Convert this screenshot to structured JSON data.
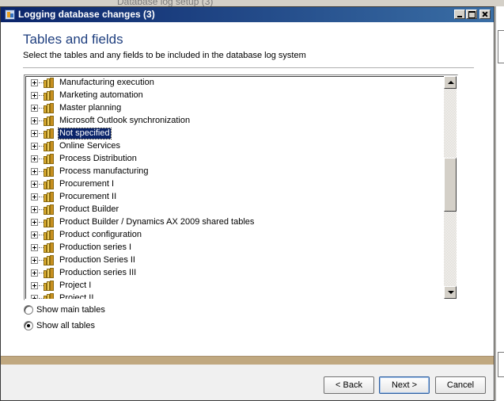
{
  "background": {
    "window_title": "Database log setup (3)"
  },
  "window": {
    "title": "Logging database changes (3)"
  },
  "page": {
    "heading": "Tables and fields",
    "subheading": "Select the tables and any fields to be included in the database log system"
  },
  "tree": {
    "selected_index": 4,
    "items": [
      {
        "label": "Manufacturing execution"
      },
      {
        "label": "Marketing automation"
      },
      {
        "label": "Master planning"
      },
      {
        "label": "Microsoft Outlook synchronization"
      },
      {
        "label": "Not specified"
      },
      {
        "label": "Online Services"
      },
      {
        "label": "Process Distribution"
      },
      {
        "label": "Process manufacturing"
      },
      {
        "label": "Procurement I"
      },
      {
        "label": "Procurement II"
      },
      {
        "label": "Product Builder"
      },
      {
        "label": "Product Builder / Dynamics AX 2009 shared tables"
      },
      {
        "label": "Product configuration"
      },
      {
        "label": "Production series I"
      },
      {
        "label": "Production Series II"
      },
      {
        "label": "Production series III"
      },
      {
        "label": "Project I"
      },
      {
        "label": "Project II"
      }
    ],
    "folder_icon": "folder-icon",
    "expander_icon": "plus-box-icon"
  },
  "options": {
    "show_main_tables": "Show main tables",
    "show_all_tables": "Show all tables",
    "selected": "show_all_tables"
  },
  "buttons": {
    "back": "< Back",
    "next": "Next >",
    "cancel": "Cancel"
  },
  "colors": {
    "titlebar_start": "#0a246a",
    "titlebar_end": "#3a6ea5",
    "heading": "#1f3f7f",
    "selection": "#0a246a",
    "footer_band": "#c0a880"
  }
}
